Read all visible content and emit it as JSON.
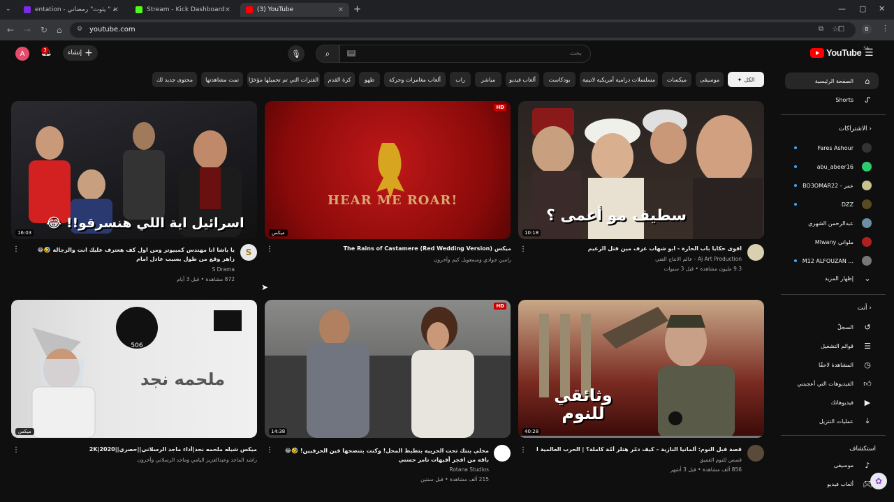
{
  "browser": {
    "tabs": [
      {
        "label": "entation - كتبة \" يثوت\" رمضاني",
        "active": false
      },
      {
        "label": "Stream - Kick Dashboard",
        "active": false
      },
      {
        "label": "(3) YouTube",
        "active": true
      }
    ],
    "new_tab": "+",
    "url": "youtube.com"
  },
  "header": {
    "avatar_letter": "A",
    "notification_count": "3",
    "create_label": "إنشاء",
    "search_placeholder": "بحث",
    "logo_text": "YouTube",
    "country_code": "SA"
  },
  "chips": [
    "الكل",
    "موسيقى",
    "ميكسات",
    "مسلسلات درامية أمريكية لاتينية",
    "بودكاست",
    "ألعاب فيديو",
    "مباشر",
    "راب",
    "ألعاب مغامرات وحركة",
    "طهو",
    "كرة القدم",
    "الفترات التي تم تحميلها مؤخرًا",
    "تمت مشاهدتها",
    "محتوى جديد لك"
  ],
  "sidebar": {
    "home": "الصفحة الرئيسية",
    "shorts": "Shorts",
    "subscriptions_heading": "الاشتراكات",
    "subscriptions": [
      {
        "name": "Fares Ashour",
        "color": "#333333"
      },
      {
        "name": "abu_abeer16",
        "color": "#2ecc71"
      },
      {
        "name": "BO3OMAR22 - عمر",
        "color": "#c9c28a"
      },
      {
        "name": "DZZ",
        "color": "#5a4a20"
      },
      {
        "name": "عبدالرحمن الشهري",
        "color": "#6b8fa3"
      },
      {
        "name": "Mlwany ملواني",
        "color": "#b02020"
      },
      {
        "name": "M12 ALFOUZAN ...",
        "color": "#777777"
      }
    ],
    "show_more": "إظهار المزيد",
    "you_heading": "أنت",
    "you_items": [
      {
        "label": "السجلّ",
        "icon": "history-icon"
      },
      {
        "label": "قوائم التشغيل",
        "icon": "playlists-icon"
      },
      {
        "label": "المشاهدة لاحقًا",
        "icon": "watch-later-icon"
      },
      {
        "label": "الفيديوهات التي أعجبتني",
        "icon": "liked-icon"
      },
      {
        "label": "فيديوهاتك",
        "icon": "your-videos-icon"
      },
      {
        "label": "عمليات التنزيل",
        "icon": "downloads-icon"
      }
    ],
    "explore_heading": "استكشاف",
    "explore_items": [
      {
        "label": "موسيقى",
        "icon": "music-icon"
      },
      {
        "label": "ألعاب فيديو",
        "icon": "gaming-icon"
      }
    ]
  },
  "videos": [
    {
      "title": "يا باشا انا مهندس كمبيوتر ومن اول كف هعترف عليك انت والرجالة 🤣😂 زاهر وقع من طول بسبب عادل امام",
      "channel": "S Drama",
      "meta": "872 مشاهدة • قبل 3 أيام",
      "duration": "16:03",
      "overlay": "اسرائيل اية اللي هنسرقو!! 😂",
      "avatar_letter": "S"
    },
    {
      "title": "ميكس The Rains of Castamere (Red Wedding Version)",
      "channel": "رامين جوادي وسمعويل كيم وآخرون",
      "meta": "",
      "duration": "ميكس",
      "overlay": "HEAR ME ROAR!",
      "avatar_letter": ""
    },
    {
      "title": "اقوى حكايا باب الحارة - ابو شهاب عرف مين قتل الزعيم",
      "channel": "Aj Art Production - عالم الانتاج الفني",
      "meta": "9.3 مليون مشاهدة • قبل 3 سنوات",
      "duration": "10:18",
      "overlay": "سطيف مو أعمى ؟",
      "avatar_letter": ""
    },
    {
      "title": "ميكس شيله ملحمه نجد|أداء ماجد الرسلاني||حصري||2020|2K",
      "channel": "راشد الماجد وعبدالعزيز اليامي وماجد الرسلاني وآخرون",
      "meta": "",
      "duration": "ميكس",
      "overlay": "ملحمه نجد",
      "avatar_letter": ""
    },
    {
      "title": "مخلي بنتك تحت الحربيه بتطبط المحل! وكنت بتنصحها فين الحرفيين! 🤣😂 باقه من افجر أفيهات تامر حسني",
      "channel": "Rotana Studios",
      "meta": "215 ألف مشاهدة • قبل سنتين",
      "duration": "14:38",
      "overlay": "",
      "avatar_letter": ""
    },
    {
      "title": "قصة قبل النوم: ألمانيا النازية – كيف دمّر هتلر أمّة كاملة؟ | الحرب العالمية الثانية",
      "channel": "قصص للنوم العميق",
      "meta": "856 ألف مشاهدة • قبل 3 أشهر",
      "duration": "40:28",
      "overlay": "وثائقي للنوم",
      "avatar_letter": ""
    }
  ],
  "colors": {
    "background": "#0f0f0f",
    "chip": "#272727",
    "accent_red": "#ff0000"
  }
}
